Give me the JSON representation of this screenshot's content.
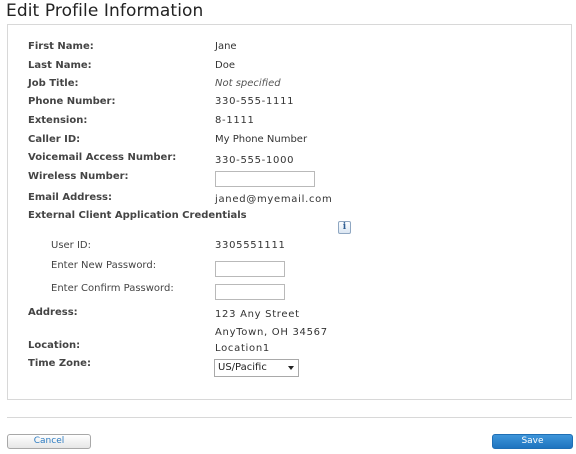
{
  "title": "Edit Profile Information",
  "fields": {
    "first_name": {
      "label": "First Name:",
      "value": "Jane"
    },
    "last_name": {
      "label": "Last Name:",
      "value": "Doe"
    },
    "job_title": {
      "label": "Job Title:",
      "value": "Not specified"
    },
    "phone_number": {
      "label": "Phone Number:",
      "value": "330-555-1111"
    },
    "extension": {
      "label": "Extension:",
      "value": "8-1111"
    },
    "caller_id": {
      "label": "Caller ID:",
      "value": "My Phone Number"
    },
    "voicemail": {
      "label": "Voicemail Access Number:",
      "value": "330-555-1000"
    },
    "wireless": {
      "label": "Wireless Number:",
      "value": ""
    },
    "email": {
      "label": "Email Address:",
      "value": "janed@myemail.com"
    }
  },
  "credentials": {
    "heading": "External Client Application Credentials",
    "info_icon": "info-icon",
    "user_id": {
      "label": "User ID:",
      "value": "3305551111"
    },
    "new_password": {
      "label": "Enter New Password:",
      "value": ""
    },
    "confirm_password": {
      "label": "Enter Confirm Password:",
      "value": ""
    }
  },
  "address": {
    "label": "Address:",
    "line1": "123 Any Street",
    "line2": "AnyTown, OH 34567"
  },
  "location": {
    "label": "Location:",
    "value": "Location1"
  },
  "time_zone": {
    "label": "Time Zone:",
    "selected": "US/Pacific"
  },
  "buttons": {
    "cancel": "Cancel",
    "save": "Save"
  },
  "colors": {
    "accent": "#1f74bf",
    "link": "#2d7bc0",
    "border": "#d8d8d8"
  }
}
